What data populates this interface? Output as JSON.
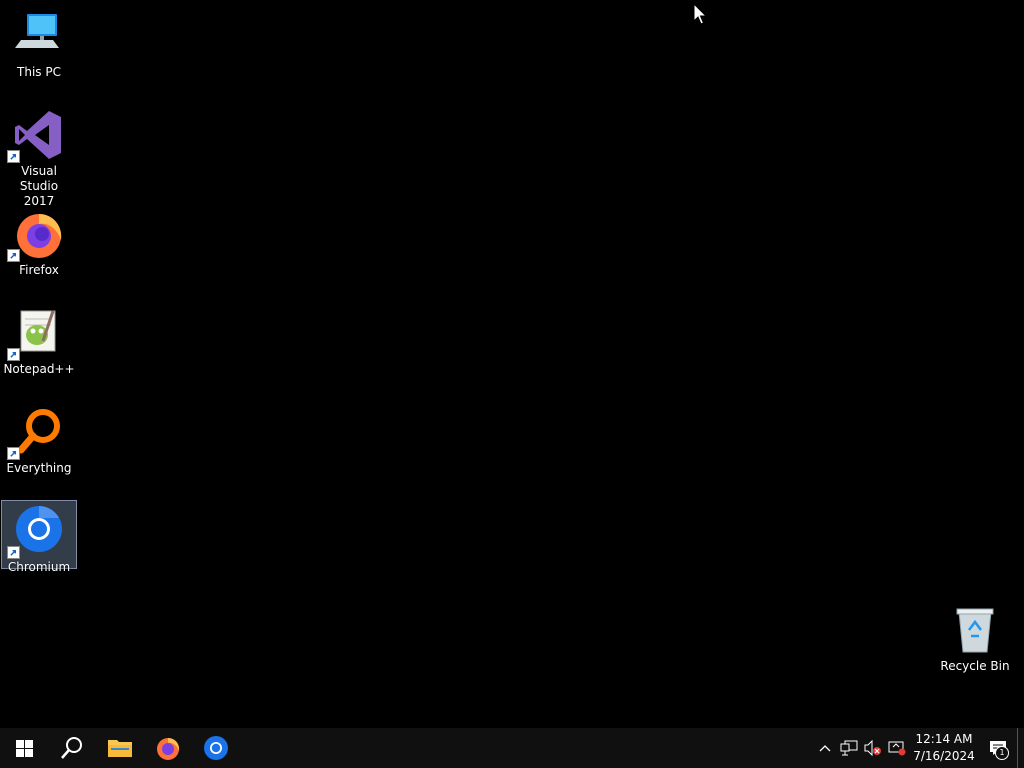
{
  "desktop": {
    "icons": [
      {
        "label": "This PC",
        "icon": "computer-icon"
      },
      {
        "label": "Visual Studio\n2017",
        "icon": "visual-studio-icon"
      },
      {
        "label": "Firefox",
        "icon": "firefox-icon"
      },
      {
        "label": "Notepad++",
        "icon": "notepadpp-icon"
      },
      {
        "label": "Everything",
        "icon": "everything-search-icon"
      },
      {
        "label": "Chromium",
        "icon": "chromium-icon",
        "selected": true
      },
      {
        "label": "Recycle Bin",
        "icon": "recycle-bin-icon"
      }
    ]
  },
  "taskbar": {
    "pinned": [
      "start-icon",
      "search-icon",
      "file-explorer-icon",
      "firefox-icon",
      "chromium-icon"
    ],
    "clock": {
      "time": "12:14 AM",
      "date": "7/16/2024"
    },
    "notification_count": "1"
  },
  "colors": {
    "desktop_bg": "#000000",
    "taskbar_bg": "#101010",
    "selection": "#a0bee6"
  }
}
